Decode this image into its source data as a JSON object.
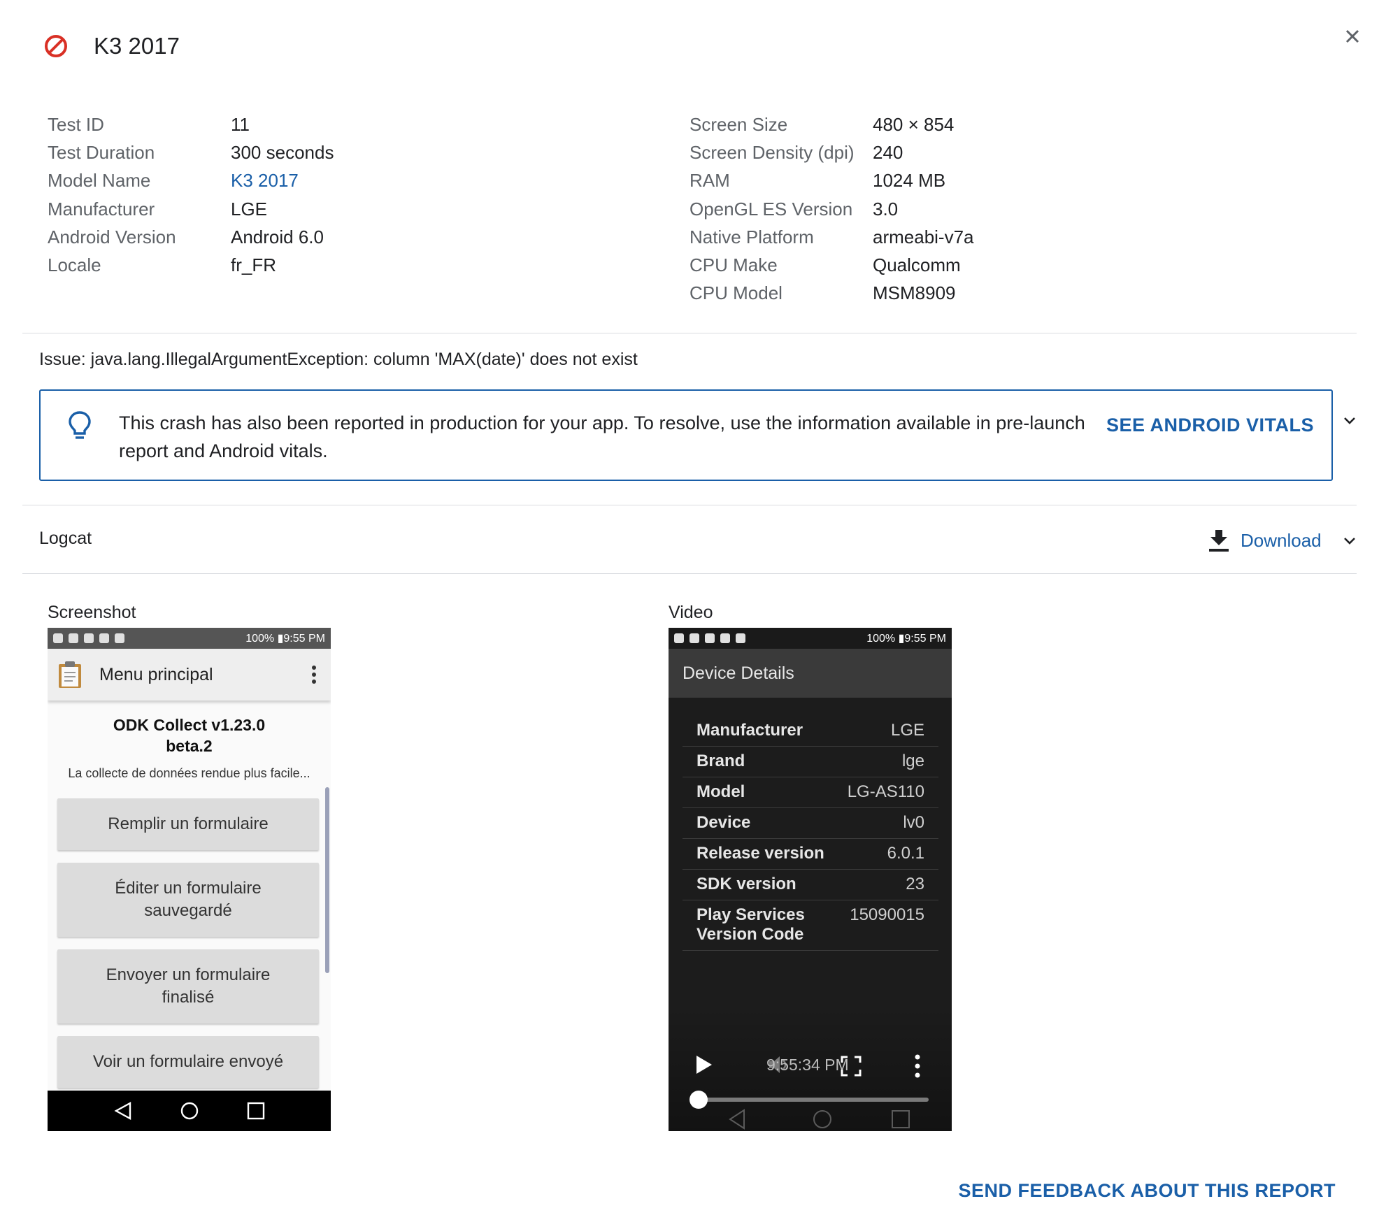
{
  "header": {
    "title": "K3 2017",
    "status_icon": "blocked-icon",
    "close_label": "×"
  },
  "device_info": {
    "left": [
      {
        "label": "Test ID",
        "value": "11"
      },
      {
        "label": "Test Duration",
        "value": "300 seconds"
      },
      {
        "label": "Model Name",
        "value": "K3 2017",
        "link": true
      },
      {
        "label": "Manufacturer",
        "value": "LGE"
      },
      {
        "label": "Android Version",
        "value": "Android 6.0"
      },
      {
        "label": "Locale",
        "value": "fr_FR"
      }
    ],
    "right": [
      {
        "label": "Screen Size",
        "value": "480 × 854"
      },
      {
        "label": "Screen Density (dpi)",
        "value": "240"
      },
      {
        "label": "RAM",
        "value": "1024 MB"
      },
      {
        "label": "OpenGL ES Version",
        "value": "3.0"
      },
      {
        "label": "Native Platform",
        "value": "armeabi-v7a"
      },
      {
        "label": "CPU Make",
        "value": "Qualcomm"
      },
      {
        "label": "CPU Model",
        "value": "MSM8909"
      }
    ]
  },
  "issue": "Issue: java.lang.IllegalArgumentException: column 'MAX(date)' does not exist",
  "banner": {
    "text": "This crash has also been reported in production for your app. To resolve, use the information available in pre-launch report and Android vitals.",
    "action": "SEE ANDROID VITALS"
  },
  "logcat": {
    "label": "Logcat",
    "download_label": "Download"
  },
  "screenshot": {
    "label": "Screenshot",
    "status_text": "100% ▮9:55 PM",
    "app_title": "Menu principal",
    "heading_line1": "ODK Collect v1.23.0",
    "heading_line2": "beta.2",
    "tagline": "La collecte de données rendue plus facile...",
    "buttons": [
      {
        "line1": "Remplir un formulaire",
        "line2": ""
      },
      {
        "line1": "Éditer un formulaire",
        "line2": "sauvegardé"
      },
      {
        "line1": "Envoyer un formulaire",
        "line2": "finalisé"
      },
      {
        "line1": "Voir un formulaire envoyé",
        "line2": ""
      }
    ]
  },
  "video": {
    "label": "Video",
    "status_text": "100% ▮9:55 PM",
    "screen_title": "Device Details",
    "details": [
      {
        "key": "Manufacturer",
        "value": "LGE"
      },
      {
        "key": "Brand",
        "value": "lge"
      },
      {
        "key": "Model",
        "value": "LG-AS110"
      },
      {
        "key": "Device",
        "value": "lv0"
      },
      {
        "key": "Release version",
        "value": "6.0.1"
      },
      {
        "key": "SDK version",
        "value": "23"
      },
      {
        "key": "Play Services Version Code",
        "value": "15090015"
      }
    ],
    "timestamp": "9:55:34 PM",
    "progress": 0.0
  },
  "footer": {
    "feedback": "SEND FEEDBACK ABOUT THIS REPORT"
  },
  "colors": {
    "accent": "#1a5fa8",
    "error": "#d93025"
  }
}
